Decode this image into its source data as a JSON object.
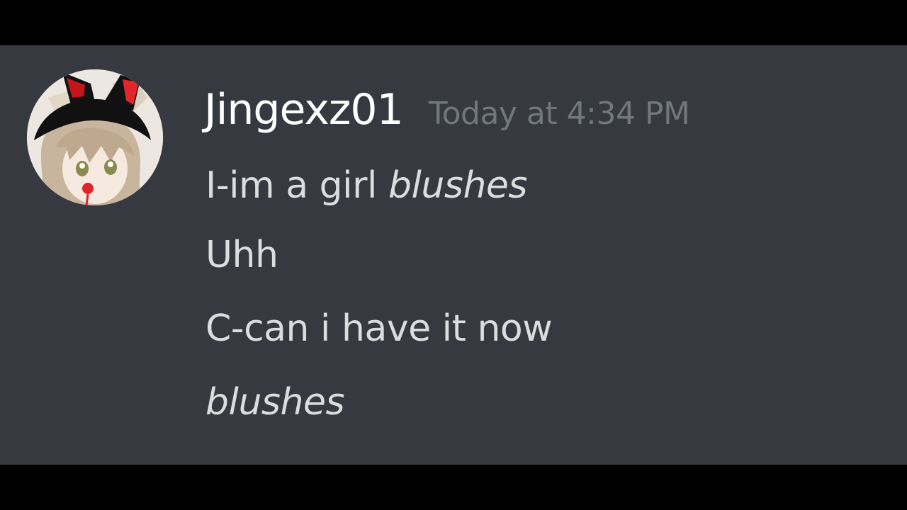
{
  "message": {
    "author": {
      "username": "Jingexz01",
      "avatar_icon": "anime-girl-avatar-icon"
    },
    "timestamp": "Today at 4:34 PM",
    "lines": [
      {
        "text": "I-im a girl ",
        "emphasis": "blushes"
      },
      {
        "text": "Uhh"
      },
      {
        "text": "C-can i have it now"
      },
      {
        "emphasis": "blushes"
      }
    ]
  },
  "colors": {
    "background": "#36393f",
    "letterbox": "#000000",
    "username": "#ffffff",
    "timestamp": "#72767d",
    "message_text": "#dcddde"
  }
}
